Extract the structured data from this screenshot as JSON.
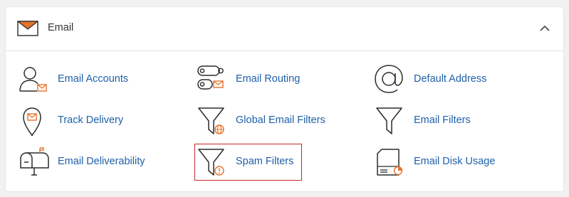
{
  "header": {
    "title": "Email",
    "icon": "envelope-icon",
    "collapse_icon": "chevron-up-icon"
  },
  "items": [
    {
      "label": "Email Accounts",
      "icon": "user-mail-icon"
    },
    {
      "label": "Email Routing",
      "icon": "routing-icon"
    },
    {
      "label": "Default Address",
      "icon": "at-sign-icon"
    },
    {
      "label": "Track Delivery",
      "icon": "location-pin-mail-icon"
    },
    {
      "label": "Global Email Filters",
      "icon": "filter-globe-icon"
    },
    {
      "label": "Email Filters",
      "icon": "filter-icon"
    },
    {
      "label": "Email Deliverability",
      "icon": "mailbox-icon"
    },
    {
      "label": "Spam Filters",
      "icon": "filter-alert-icon",
      "highlighted": true
    },
    {
      "label": "Email Disk Usage",
      "icon": "disk-usage-icon"
    }
  ],
  "colors": {
    "link": "#1e5fa8",
    "accent": "#e8722a",
    "highlight_border": "#c62828",
    "icon_stroke": "#2b2b2b"
  }
}
